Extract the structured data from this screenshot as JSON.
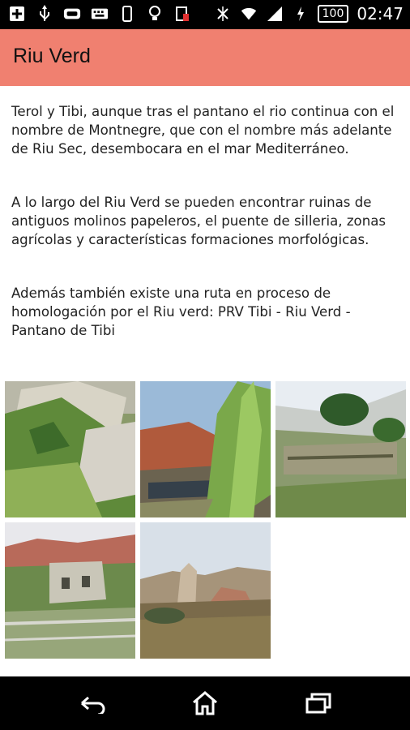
{
  "status_bar": {
    "time": "02:47",
    "battery": "100",
    "icons": [
      "add-box-icon",
      "usb-icon",
      "controller-icon",
      "keyboard-icon",
      "phone-icon",
      "lightbulb-icon",
      "sim-icon",
      "no-bluetooth-icon",
      "wifi-icon",
      "signal-icon",
      "charging-icon"
    ]
  },
  "app_bar": {
    "title": "Riu Verd",
    "color": "#f08070"
  },
  "article": {
    "paragraph_1": "Terol y Tibi, aunque tras el pantano el rio continua con el nombre de Montnegre, que con el nombre más adelante de Riu Sec, desembocara en el mar Mediterráneo.",
    "paragraph_2": "A lo largo del Riu Verd se pueden encontrar ruinas de antiguos molinos papeleros, el puente de silleria, zonas agrícolas y características formaciones morfológicas.",
    "paragraph_3": "Además también existe una ruta en proceso de homologación por el Riu verd: PRV Tibi - Riu Verd - Pantano de Tibi"
  },
  "gallery": {
    "photos": [
      "river-vegetation-photo",
      "river-bank-canes-photo",
      "mill-ruins-hill-photo",
      "paper-mill-ruins-photo",
      "rock-formation-photo"
    ]
  },
  "nav_bar": {
    "buttons": [
      "back-icon",
      "home-icon",
      "recents-icon"
    ]
  }
}
